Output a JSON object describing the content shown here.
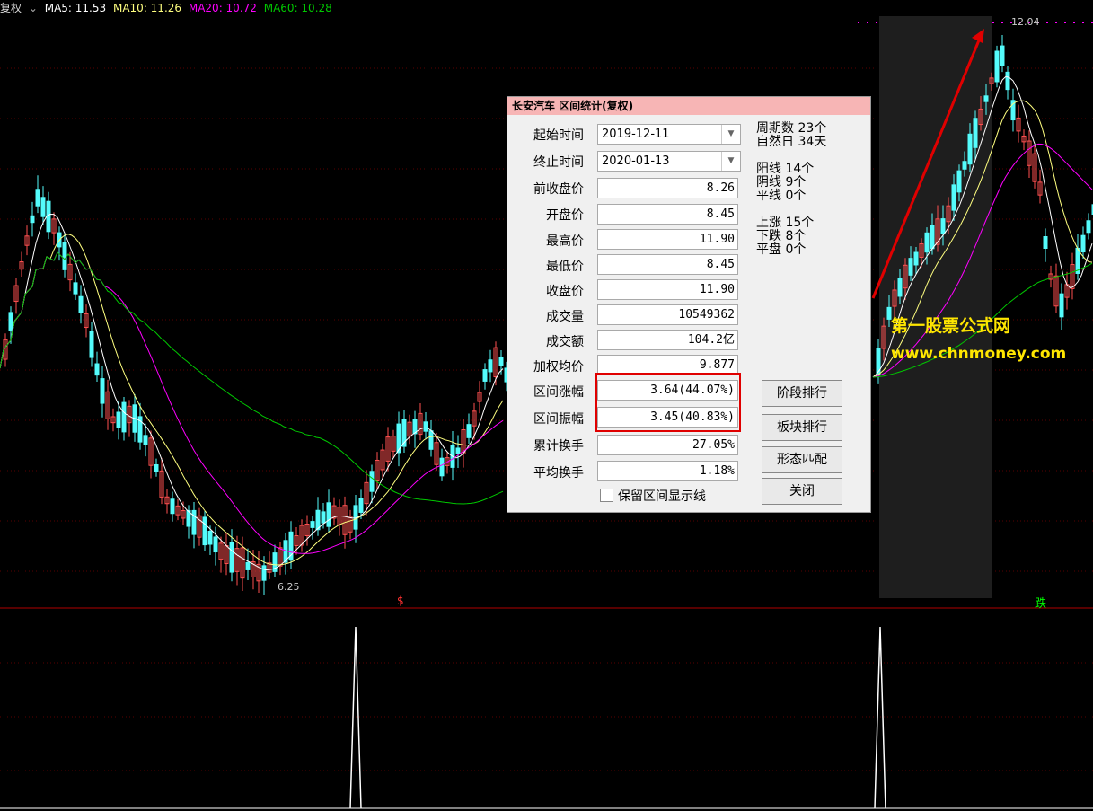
{
  "header": {
    "mode": "复权",
    "ma5": "MA5: 11.53",
    "ma10": "MA10: 11.26",
    "ma20": "MA20: 10.72",
    "ma60": "MA60: 10.28"
  },
  "chart_labels": {
    "high_price": "12.04",
    "low_price": "6.25",
    "signal_left": "$",
    "signal_right": "跌"
  },
  "colors": {
    "ma5": "#ffffff",
    "ma10": "#ffff80",
    "ma20": "#ff00ff",
    "ma60": "#00c800",
    "up": "#ff5050",
    "down": "#54fcfc",
    "watermark": "#ffe600"
  },
  "dialog": {
    "title": "长安汽车 区间统计(复权)",
    "fields": {
      "start_label": "起始时间",
      "start_value": "2019-12-11",
      "end_label": "终止时间",
      "end_value": "2020-01-13",
      "prev_close_label": "前收盘价",
      "prev_close_value": "8.26",
      "open_label": "开盘价",
      "open_value": "8.45",
      "high_label": "最高价",
      "high_value": "11.90",
      "low_label": "最低价",
      "low_value": "8.45",
      "close_label": "收盘价",
      "close_value": "11.90",
      "volume_label": "成交量",
      "volume_value": "10549362",
      "amount_label": "成交额",
      "amount_value": "104.2亿",
      "wavg_label": "加权均价",
      "wavg_value": "9.877",
      "rise_label": "区间涨幅",
      "rise_value": "3.64(44.07%)",
      "swing_label": "区间振幅",
      "swing_value": "3.45(40.83%)",
      "cum_turn_label": "累计换手",
      "cum_turn_value": "27.05%",
      "avg_turn_label": "平均换手",
      "avg_turn_value": "1.18%"
    },
    "stats": {
      "periods": "周期数 23个",
      "natural_days": "自然日 34天",
      "yang": "阳线 14个",
      "yin": "阴线 9个",
      "flat_line": "平线 0个",
      "up_count": "上涨 15个",
      "down_count": "下跌 8个",
      "flat_count": "平盘 0个"
    },
    "buttons": {
      "stage_rank": "阶段排行",
      "sector_rank": "板块排行",
      "pattern_match": "形态匹配",
      "close": "关闭"
    },
    "checkbox_label": "保留区间显示线"
  },
  "watermark": {
    "line1": "第一股票公式网",
    "line2": "www.chnmoney.com"
  }
}
